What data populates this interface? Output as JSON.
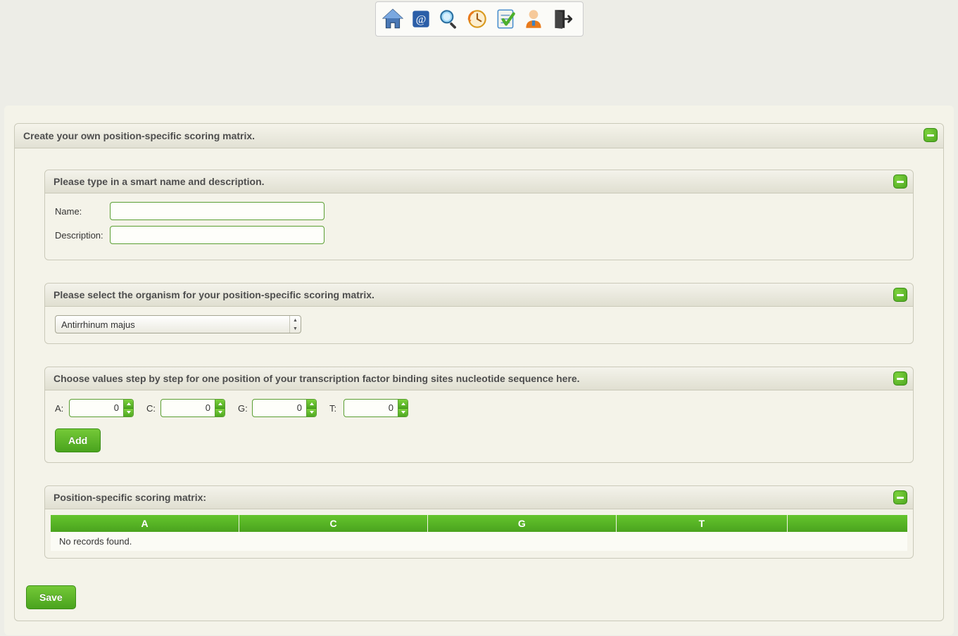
{
  "toolbar": {
    "icons": [
      "home-icon",
      "contacts-icon",
      "search-icon",
      "history-icon",
      "tasks-icon",
      "user-icon",
      "exit-icon"
    ]
  },
  "main": {
    "title": "Create your own position-specific scoring matrix."
  },
  "section_name": {
    "title": "Please type in a smart name and description.",
    "name_label": "Name:",
    "name_value": "",
    "desc_label": "Description:",
    "desc_value": ""
  },
  "section_organism": {
    "title": "Please select the organism for your position-specific scoring matrix.",
    "selected": "Antirrhinum majus"
  },
  "section_values": {
    "title": "Choose values step by step for one position of your transcription factor binding sites nucleotide sequence here.",
    "a_label": "A:",
    "a_val": "0",
    "c_label": "C:",
    "c_val": "0",
    "g_label": "G:",
    "g_val": "0",
    "t_label": "T:",
    "t_val": "0",
    "add_label": "Add"
  },
  "section_matrix": {
    "title": "Position-specific scoring matrix:",
    "headers": [
      "A",
      "C",
      "G",
      "T",
      ""
    ],
    "empty_msg": "No records found."
  },
  "save_label": "Save"
}
